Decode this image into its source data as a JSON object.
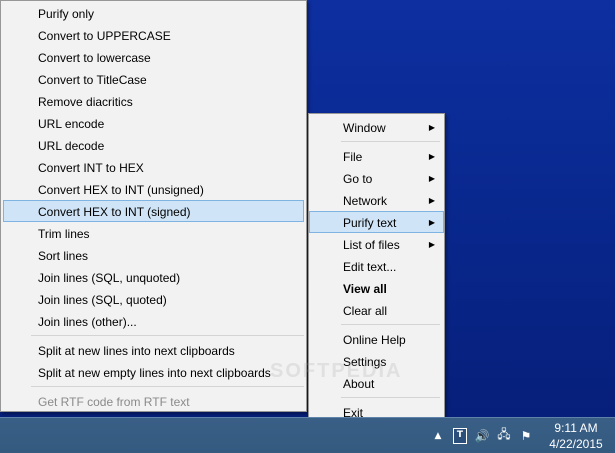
{
  "submenu": {
    "items": [
      {
        "label": "Purify only"
      },
      {
        "label": "Convert to UPPERCASE"
      },
      {
        "label": "Convert to lowercase"
      },
      {
        "label": "Convert to TitleCase"
      },
      {
        "label": "Remove diacritics"
      },
      {
        "label": "URL encode"
      },
      {
        "label": "URL decode"
      },
      {
        "label": "Convert INT to HEX"
      },
      {
        "label": "Convert HEX to INT (unsigned)"
      },
      {
        "label": "Convert HEX to INT (signed)"
      },
      {
        "label": "Trim lines"
      },
      {
        "label": "Sort lines"
      },
      {
        "label": "Join lines (SQL, unquoted)"
      },
      {
        "label": "Join lines (SQL, quoted)"
      },
      {
        "label": "Join lines (other)..."
      }
    ],
    "split_items": [
      {
        "label": "Split at new lines into next clipboards"
      },
      {
        "label": "Split at new empty lines into next clipboards"
      }
    ],
    "disabled_item": {
      "label": "Get RTF code from RTF text"
    },
    "highlighted_label": "Convert HEX to INT (signed)"
  },
  "main_menu": {
    "window": "Window",
    "file": "File",
    "go_to": "Go to",
    "network": "Network",
    "purify_text": "Purify text",
    "list_of_files": "List of files",
    "edit_text": "Edit text...",
    "view_all": "View all",
    "clear_all": "Clear all",
    "online_help": "Online Help",
    "settings": "Settings",
    "about": "About",
    "exit": "Exit",
    "arrow_glyph": "▶"
  },
  "watermark": "SOFTPEDIA",
  "tray": {
    "expand_glyph": "▲",
    "app_glyph": "T",
    "volume_glyph": "🔊",
    "network_glyph": "🖧",
    "flag_glyph": "⚑",
    "time": "9:11 AM",
    "date": "4/22/2015"
  },
  "colors": {
    "desktop": "#08268a",
    "taskbar": "#345a80",
    "menu_bg": "#f2f2f2",
    "highlight_bg": "#cfe4f6",
    "highlight_border": "#7fb4e2"
  }
}
